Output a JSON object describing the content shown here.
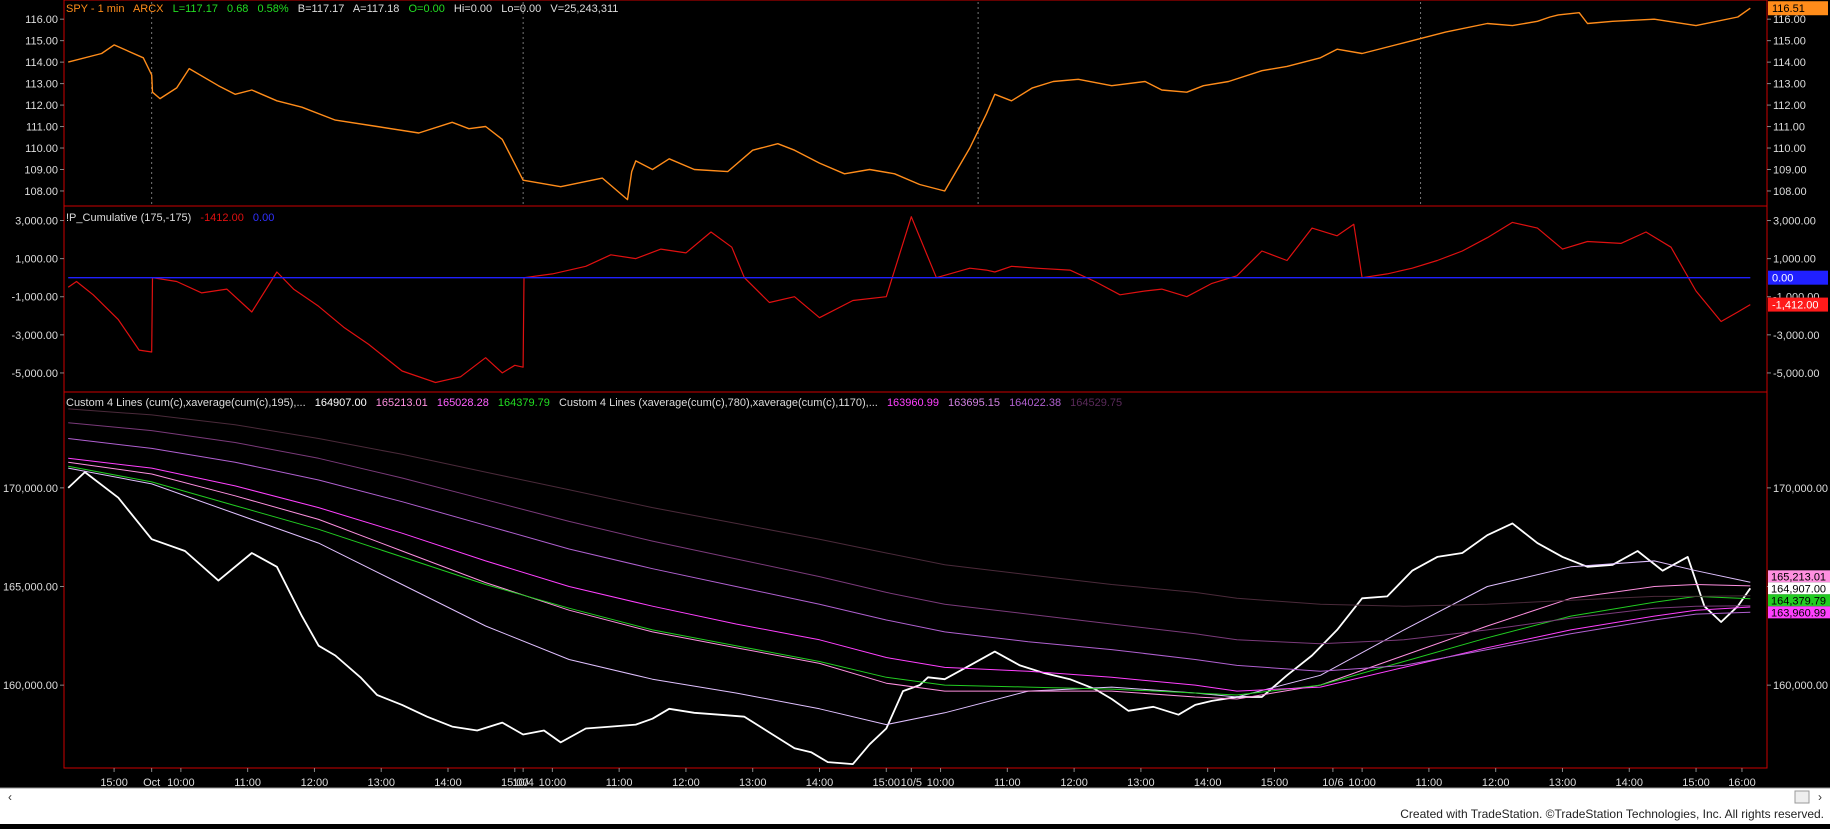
{
  "header": {
    "symbol": "SPY - 1 min",
    "exchange": "ARCX",
    "last": "L=117.17",
    "change": "0.68",
    "change_pct": "0.58%",
    "bid": "B=117.17",
    "ask": "A=117.18",
    "open": "O=0.00",
    "hi": "Hi=0.00",
    "lo": "Lo=0.00",
    "volume": "V=25,243,311"
  },
  "indicator2": {
    "name": "!P_Cumulative (175,-175)",
    "value1": "-1412.00",
    "value2": "0.00"
  },
  "indicator3": {
    "name1": "Custom 4 Lines (cum(c),xaverage(cum(c),195),...",
    "vals1": [
      "164907.00",
      "165213.01",
      "165028.28",
      "164379.79"
    ],
    "name2": "Custom 4 Lines (xaverage(cum(c),780),xaverage(cum(c),1170),...",
    "vals2": [
      "163960.99",
      "163695.15",
      "164022.38",
      "164529.75"
    ]
  },
  "footer": "Created with TradeStation. ©TradeStation Technologies, Inc. All rights reserved.",
  "colors": {
    "price": "#ff8c1a",
    "cumulative": "#e01010",
    "zero": "#2020ff",
    "cum_line": "#ffffff",
    "green": "#22cc22",
    "magenta": "#ff40ff",
    "pink": "#ff90e0",
    "violet": "#b060d0",
    "lavender": "#e0c0ff",
    "dark_purple": "#7a3a7a",
    "light_pink": "#f0d0f0",
    "axis_text": "#dddddd",
    "border": "#cc0000"
  },
  "chart_data": [
    {
      "type": "line",
      "title": "SPY - 1 min",
      "series": [
        {
          "name": "SPY",
          "x": [
            0.0,
            0.4,
            0.55,
            0.9,
            1.0,
            1.01,
            1.1,
            1.3,
            1.45,
            1.8,
            2.0,
            2.2,
            2.5,
            2.8,
            3.2,
            3.7,
            4.2,
            4.6,
            4.8,
            5.0,
            5.2,
            5.45,
            5.9,
            6.4,
            6.7,
            6.75,
            6.8,
            7.0,
            7.2,
            7.5,
            7.9,
            8.2,
            8.5,
            8.7,
            9.0,
            9.3,
            9.6,
            9.9,
            10.2,
            10.5,
            10.8,
            11.0,
            11.1,
            11.3,
            11.55,
            11.8,
            12.1,
            12.5,
            12.9,
            13.1,
            13.4,
            13.6,
            13.9,
            14.3,
            14.6,
            15.0,
            15.2,
            15.5,
            16.0,
            16.5,
            17.0,
            17.3,
            17.6,
            17.75,
            17.85,
            18.1,
            18.2,
            18.5,
            19.0,
            19.5,
            20.0,
            20.15
          ],
          "values": [
            114.0,
            114.4,
            114.8,
            114.2,
            113.4,
            112.6,
            112.3,
            112.8,
            113.7,
            112.9,
            112.5,
            112.7,
            112.2,
            111.9,
            111.3,
            111.0,
            110.7,
            111.2,
            110.9,
            111.0,
            110.4,
            108.5,
            108.2,
            108.6,
            107.6,
            108.9,
            109.4,
            109.0,
            109.5,
            109.0,
            108.9,
            109.9,
            110.2,
            109.9,
            109.3,
            108.8,
            109.0,
            108.8,
            108.3,
            108.0,
            110.0,
            111.6,
            112.5,
            112.2,
            112.8,
            113.1,
            113.2,
            112.9,
            113.1,
            112.7,
            112.6,
            112.9,
            113.1,
            113.6,
            113.8,
            114.2,
            114.6,
            114.4,
            114.9,
            115.4,
            115.8,
            115.7,
            115.9,
            116.1,
            116.2,
            116.3,
            115.8,
            115.9,
            116.0,
            115.7,
            116.1,
            116.51
          ]
        }
      ],
      "ylim": [
        107.3,
        116.8
      ],
      "ticks": [
        "116.00",
        "115.00",
        "114.00",
        "113.00",
        "112.00",
        "111.00",
        "110.00",
        "109.00",
        "108.00"
      ],
      "tick_values": [
        116,
        115,
        114,
        113,
        112,
        111,
        110,
        109,
        108
      ],
      "last_label": "116.51",
      "grid": false
    },
    {
      "type": "line",
      "title": "!P_Cumulative (175,-175)",
      "series": [
        {
          "name": "!P_Cumulative",
          "x": [
            0.0,
            0.1,
            0.3,
            0.6,
            0.85,
            1.0,
            1.01,
            1.3,
            1.6,
            1.9,
            2.2,
            2.5,
            2.7,
            3.0,
            3.3,
            3.6,
            4.0,
            4.4,
            4.7,
            5.0,
            5.2,
            5.35,
            5.45,
            5.46,
            5.8,
            6.2,
            6.5,
            6.8,
            7.1,
            7.4,
            7.7,
            7.95,
            8.1,
            8.4,
            8.7,
            9.0,
            9.4,
            9.8,
            10.1,
            10.4,
            10.8,
            11.0,
            11.1,
            11.3,
            11.6,
            12.0,
            12.3,
            12.6,
            12.9,
            13.1,
            13.4,
            13.7,
            14.0,
            14.3,
            14.6,
            14.9,
            15.2,
            15.4,
            15.5,
            15.8,
            16.1,
            16.4,
            16.7,
            17.0,
            17.3,
            17.6,
            17.9,
            18.2,
            18.6,
            18.9,
            19.2,
            19.5,
            19.8,
            20.0,
            20.15
          ],
          "values": [
            -500,
            -200,
            -900,
            -2200,
            -3800,
            -3900,
            0,
            -200,
            -800,
            -600,
            -1800,
            300,
            -600,
            -1500,
            -2600,
            -3500,
            -4900,
            -5500,
            -5200,
            -4200,
            -5000,
            -4600,
            -4700,
            0,
            200,
            600,
            1200,
            1000,
            1500,
            1300,
            2400,
            1600,
            0,
            -1300,
            -1000,
            -2100,
            -1200,
            -1000,
            3200,
            0,
            500,
            400,
            300,
            600,
            500,
            400,
            -200,
            -900,
            -700,
            -600,
            -1000,
            -300,
            100,
            1400,
            900,
            2600,
            2200,
            2800,
            0,
            200,
            500,
            900,
            1400,
            2100,
            2900,
            2600,
            1500,
            1900,
            1800,
            2400,
            1600,
            -700,
            -2300,
            -1800,
            -1412
          ]
        },
        {
          "name": "zero",
          "x": [
            0,
            20.15
          ],
          "values": [
            0,
            0
          ]
        }
      ],
      "ylim": [
        -6000,
        3500
      ],
      "ticks": [
        "3,000.00",
        "1,000.00",
        "-1,000.00",
        "-3,000.00",
        "-5,000.00"
      ],
      "tick_values": [
        3000,
        1000,
        -1000,
        -3000,
        -5000
      ],
      "last_labels": [
        "0.00",
        "-1,412.00"
      ],
      "grid": false
    },
    {
      "type": "line",
      "title": "Custom 4 Lines",
      "series": [
        {
          "name": "cum(c)",
          "x": [
            0.0,
            0.2,
            0.6,
            1.0,
            1.4,
            1.8,
            2.2,
            2.5,
            2.8,
            3.0,
            3.2,
            3.5,
            3.7,
            4.0,
            4.3,
            4.6,
            4.9,
            5.2,
            5.45,
            5.7,
            5.9,
            6.2,
            6.5,
            6.8,
            7.0,
            7.2,
            7.5,
            7.8,
            8.1,
            8.4,
            8.7,
            8.9,
            9.1,
            9.4,
            9.6,
            9.8,
            10.0,
            10.2,
            10.3,
            10.5,
            10.8,
            11.1,
            11.4,
            11.7,
            12.0,
            12.3,
            12.5,
            12.7,
            13.0,
            13.3,
            13.5,
            13.7,
            14.0,
            14.3,
            14.6,
            14.9,
            15.2,
            15.5,
            15.8,
            16.1,
            16.4,
            16.7,
            17.0,
            17.3,
            17.6,
            17.9,
            18.2,
            18.5,
            18.8,
            19.1,
            19.4,
            19.6,
            19.8,
            20.0,
            20.15
          ],
          "values": [
            170000,
            170800,
            169500,
            167400,
            166800,
            165300,
            166700,
            166000,
            163500,
            162000,
            161500,
            160400,
            159500,
            159000,
            158400,
            157900,
            157700,
            158100,
            157500,
            157700,
            157100,
            157800,
            157900,
            158000,
            158300,
            158800,
            158600,
            158500,
            158400,
            157600,
            156800,
            156600,
            156100,
            156000,
            157000,
            157800,
            159700,
            160000,
            160400,
            160300,
            161000,
            161700,
            161000,
            160600,
            160300,
            159800,
            159300,
            158700,
            158900,
            158500,
            159000,
            159200,
            159400,
            159400,
            160500,
            161500,
            162800,
            164400,
            164500,
            165800,
            166500,
            166700,
            167600,
            168200,
            167200,
            166500,
            166000,
            166100,
            166800,
            165800,
            166500,
            164000,
            163200,
            164000,
            164907
          ]
        },
        {
          "name": "xavg 195",
          "x": [
            0.0,
            1.0,
            2.0,
            3.0,
            4.0,
            5.0,
            6.0,
            7.0,
            8.0,
            9.0,
            9.8,
            10.5,
            11.5,
            12.5,
            13.5,
            14.0,
            15.0,
            16.0,
            17.0,
            18.0,
            19.0,
            19.5,
            20.15
          ],
          "values": [
            171000,
            170200,
            168700,
            167200,
            165100,
            163000,
            161300,
            160300,
            159600,
            158800,
            158000,
            158600,
            159700,
            159900,
            159600,
            159400,
            160500,
            162800,
            165000,
            166000,
            166300,
            165800,
            165213
          ]
        },
        {
          "name": "xavg 390",
          "x": [
            0.0,
            1.0,
            2.0,
            3.0,
            4.0,
            5.0,
            6.0,
            7.0,
            8.0,
            9.0,
            9.8,
            10.5,
            11.5,
            12.5,
            13.5,
            14.0,
            15.0,
            16.0,
            17.0,
            18.0,
            19.0,
            19.5,
            20.15
          ],
          "values": [
            171300,
            170700,
            169600,
            168400,
            166800,
            165200,
            163800,
            162700,
            161900,
            161100,
            160100,
            159700,
            159700,
            159700,
            159400,
            159300,
            160000,
            161500,
            163000,
            164400,
            165000,
            165100,
            165028
          ]
        },
        {
          "name": "xavg 585",
          "x": [
            0.0,
            1.0,
            2.0,
            3.0,
            4.0,
            5.0,
            6.0,
            7.0,
            8.0,
            9.0,
            9.8,
            10.5,
            11.5,
            12.5,
            13.5,
            14.0,
            15.0,
            16.0,
            17.0,
            18.0,
            19.0,
            19.5,
            20.15
          ],
          "values": [
            171100,
            170300,
            169100,
            167900,
            166500,
            165100,
            163900,
            162800,
            162000,
            161200,
            160400,
            160000,
            159900,
            159800,
            159600,
            159500,
            160000,
            161200,
            162400,
            163500,
            164200,
            164500,
            164380
          ]
        },
        {
          "name": "xavg 780",
          "x": [
            0.0,
            1.0,
            2.0,
            3.0,
            4.0,
            5.0,
            6.0,
            7.0,
            8.0,
            9.0,
            9.8,
            10.5,
            11.5,
            12.5,
            13.5,
            14.0,
            15.0,
            16.0,
            17.0,
            18.0,
            19.0,
            19.5,
            20.15
          ],
          "values": [
            171500,
            171000,
            170100,
            169000,
            167700,
            166300,
            165000,
            164000,
            163100,
            162300,
            161400,
            160900,
            160700,
            160400,
            160000,
            159700,
            159900,
            160900,
            161900,
            162800,
            163500,
            163800,
            163961
          ]
        },
        {
          "name": "xavg 1170",
          "x": [
            0.0,
            1.0,
            2.0,
            3.0,
            4.0,
            5.0,
            6.0,
            7.0,
            8.0,
            9.0,
            9.8,
            10.5,
            11.5,
            12.5,
            13.5,
            14.0,
            15.0,
            16.0,
            17.0,
            18.0,
            19.0,
            19.5,
            20.15
          ],
          "values": [
            172500,
            172000,
            171300,
            170400,
            169300,
            168100,
            166900,
            165900,
            165000,
            164100,
            163300,
            162700,
            162200,
            161800,
            161300,
            161000,
            160700,
            161000,
            161800,
            162600,
            163300,
            163600,
            163695
          ]
        },
        {
          "name": "xavg 1560",
          "x": [
            0.0,
            1.0,
            2.0,
            3.0,
            4.0,
            5.0,
            6.0,
            7.0,
            8.0,
            9.0,
            9.8,
            10.5,
            11.5,
            12.5,
            13.5,
            14.0,
            15.0,
            16.0,
            17.0,
            18.0,
            19.0,
            19.5,
            20.15
          ],
          "values": [
            173300,
            172900,
            172300,
            171500,
            170500,
            169400,
            168300,
            167300,
            166400,
            165500,
            164700,
            164100,
            163600,
            163100,
            162600,
            162300,
            162100,
            162300,
            162800,
            163400,
            163900,
            164000,
            164022
          ]
        },
        {
          "name": "xavg 1950",
          "x": [
            0.0,
            1.0,
            2.0,
            3.0,
            4.0,
            5.0,
            6.0,
            7.0,
            8.0,
            9.0,
            9.8,
            10.5,
            11.5,
            12.5,
            13.5,
            14.0,
            15.0,
            16.0,
            17.0,
            18.0,
            19.0,
            19.5,
            20.15
          ],
          "values": [
            174000,
            173700,
            173200,
            172500,
            171700,
            170800,
            169900,
            169000,
            168200,
            167400,
            166700,
            166100,
            165600,
            165100,
            164700,
            164400,
            164100,
            164000,
            164100,
            164300,
            164500,
            164500,
            164530
          ]
        }
      ],
      "ylim": [
        155800,
        174200
      ],
      "ticks": [
        "170,000.00",
        "165,000.00",
        "160,000.00"
      ],
      "tick_values": [
        170000,
        165000,
        160000
      ],
      "last_labels": [
        "165,213.01",
        "164,907.00",
        "164,379.79",
        "163,960.99"
      ],
      "grid": false
    }
  ],
  "x_axis": {
    "labels": [
      "15:00",
      "Oct",
      "10:00",
      "11:00",
      "12:00",
      "13:00",
      "14:00",
      "15:00",
      "10/4",
      "10:00",
      "11:00",
      "12:00",
      "13:00",
      "14:00",
      "15:00",
      "10/5",
      "10:00",
      "11:00",
      "12:00",
      "13:00",
      "14:00",
      "15:00",
      "10/6",
      "10:00",
      "11:00",
      "12:00",
      "13:00",
      "14:00",
      "15:00",
      "16:00"
    ],
    "positions": [
      0.55,
      1.0,
      1.35,
      2.15,
      2.95,
      3.75,
      4.55,
      5.35,
      5.45,
      5.8,
      6.6,
      7.4,
      8.2,
      9.0,
      9.8,
      10.1,
      10.45,
      11.25,
      12.05,
      12.85,
      13.65,
      14.45,
      15.15,
      15.5,
      16.3,
      17.1,
      17.9,
      18.7,
      19.5,
      20.05
    ],
    "session_breaks": [
      1.0,
      5.45,
      10.9,
      16.2
    ],
    "range": [
      -0.05,
      20.35
    ]
  }
}
